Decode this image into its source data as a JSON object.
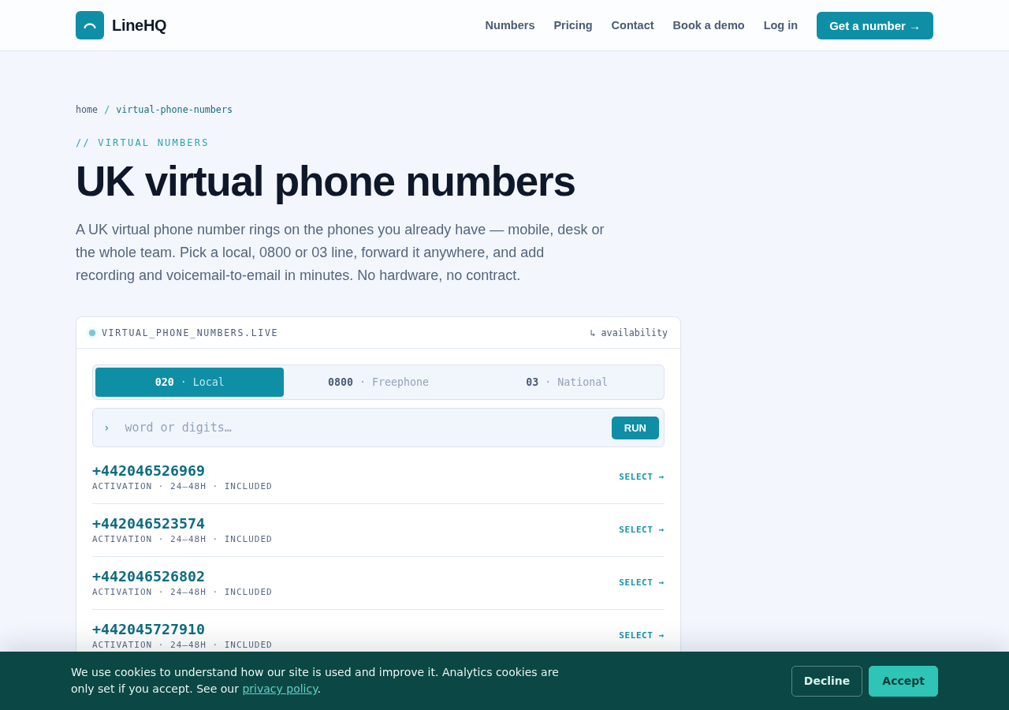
{
  "header": {
    "brand": "LineHQ",
    "nav": [
      {
        "label": "Numbers"
      },
      {
        "label": "Pricing"
      },
      {
        "label": "Contact"
      },
      {
        "label": "Book a demo"
      },
      {
        "label": "Log in"
      }
    ],
    "cta": "Get a number →"
  },
  "breadcrumb": {
    "separator": "/",
    "items": [
      {
        "label": "home",
        "current": false
      },
      {
        "label": "virtual-phone-numbers",
        "current": true
      }
    ]
  },
  "eyebrow": "// VIRTUAL NUMBERS",
  "title": "UK virtual phone numbers",
  "intro": "A UK virtual phone number rings on the phones you already have — mobile, desk or the whole team. Pick a local, 0800 or 03 line, forward it anywhere, and add recording and voicemail-to-email in minutes. No hardware, no contract.",
  "panel": {
    "title": "VIRTUAL_PHONE_NUMBERS.LIVE",
    "link": "↳ availability",
    "tabs": [
      {
        "label": "**020** · Local",
        "selected": true
      },
      {
        "label": "**0800** · Freephone",
        "selected": false
      },
      {
        "label": "**03** · National",
        "selected": false
      }
    ],
    "search": {
      "prompt": "›",
      "placeholder": "word or digits…",
      "button": "RUN"
    },
    "numbers": [
      {
        "number": "+442046526969",
        "details": "ACTIVATION · 24–48H · INCLUDED",
        "action": "SELECT →"
      },
      {
        "number": "+442046523574",
        "details": "ACTIVATION · 24–48H · INCLUDED",
        "action": "SELECT →"
      },
      {
        "number": "+442046526802",
        "details": "ACTIVATION · 24–48H · INCLUDED",
        "action": "SELECT →"
      },
      {
        "number": "+442045727910",
        "details": "ACTIVATION · 24–48H · INCLUDED",
        "action": "SELECT →"
      }
    ]
  },
  "cookie_banner": {
    "text": "We use cookies to understand how our site is used and improve it. Analytics cookies are only set if you accept. See our ",
    "link": "privacy policy",
    "text_end": ".",
    "buttons": [
      {
        "label": "Decline",
        "kind": "secondary"
      },
      {
        "label": "Accept",
        "kind": "primary"
      }
    ]
  }
}
